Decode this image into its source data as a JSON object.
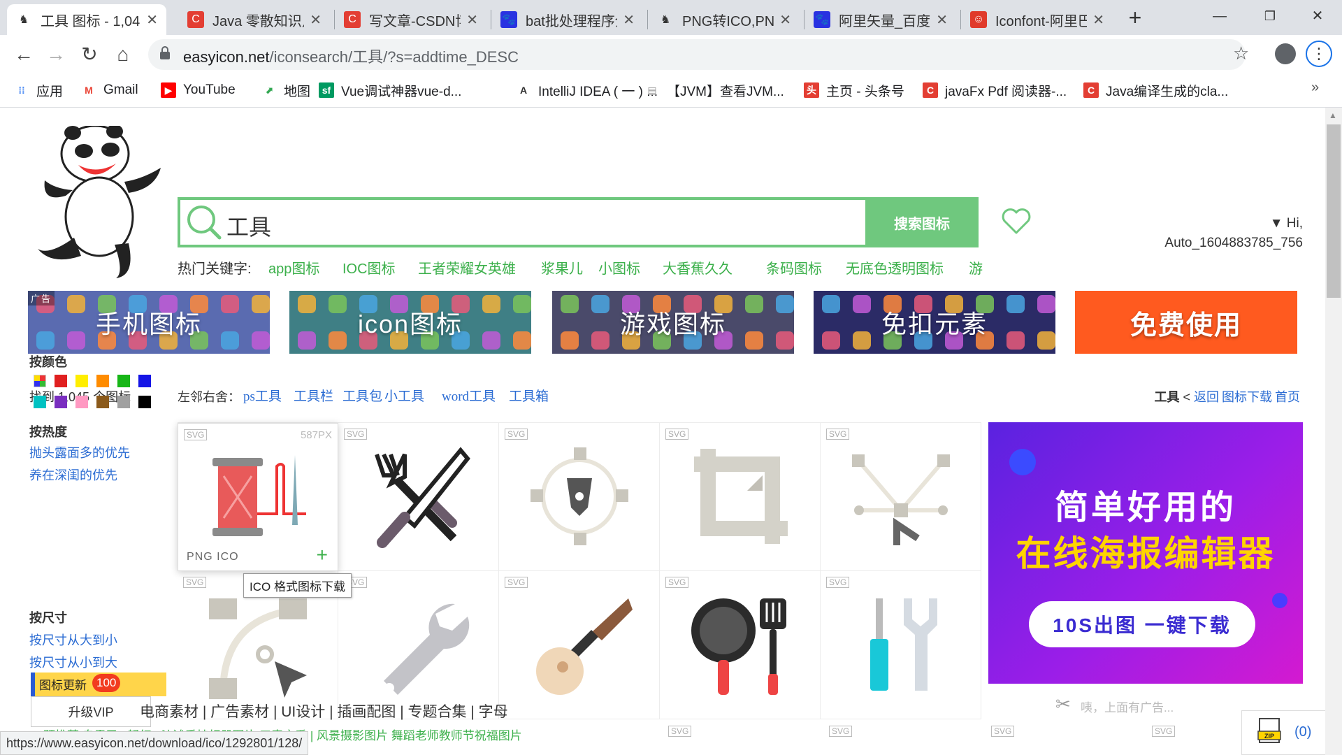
{
  "browser": {
    "tabs": [
      {
        "title": "工具 图标 - 1,045",
        "icon": "panda-favicon",
        "icon_color": "#333333",
        "active": true
      },
      {
        "title": "Java 零散知识点",
        "icon": "csdn-favicon",
        "icon_color": "#e33e33"
      },
      {
        "title": "写文章-CSDN博客",
        "icon": "csdn-favicon",
        "icon_color": "#e33e33"
      },
      {
        "title": "bat批处理程序介绍",
        "icon": "baidu-paw-favicon",
        "icon_color": "#2932e1"
      },
      {
        "title": "PNG转ICO,PNG",
        "icon": "panda-favicon",
        "icon_color": "#333333"
      },
      {
        "title": "阿里矢量_百度搜索",
        "icon": "baidu-paw-favicon",
        "icon_color": "#2932e1"
      },
      {
        "title": "Iconfont-阿里巴巴",
        "icon": "iconfont-favicon",
        "icon_color": "#e03a2b"
      }
    ],
    "close_glyph": "✕",
    "new_tab_glyph": "+",
    "window_controls": {
      "minimize": "—",
      "maximize": "❐",
      "close": "✕"
    },
    "nav": {
      "back": "←",
      "forward": "→",
      "reload": "↻",
      "home": "⌂"
    },
    "url": {
      "host": "easyicon.net",
      "path": "/iconsearch/工具/?s=addtime_DESC"
    },
    "menu_glyph": "⋮",
    "bookmarks": [
      {
        "label": "应用",
        "icon": "apps-grid-icon",
        "color": "#4285f4"
      },
      {
        "label": "Gmail",
        "icon": "gmail-icon",
        "color": "#ea4335"
      },
      {
        "label": "YouTube",
        "icon": "youtube-icon",
        "color": "#ff0000"
      },
      {
        "label": "地图",
        "icon": "maps-icon",
        "color": "#34a853"
      },
      {
        "label": "Vue调试神器vue-d...",
        "icon": "segmentfault-icon",
        "color": "#009a61"
      },
      {
        "label": "IntelliJ IDEA ( 一 ) ...",
        "icon": "intellij-icon",
        "color": "#333333"
      },
      {
        "label": "【JVM】查看JVM...",
        "icon": "doc-icon",
        "color": "#999999"
      },
      {
        "label": "主页 - 头条号",
        "icon": "toutiao-icon",
        "color": "#e33e33"
      },
      {
        "label": "javaFx Pdf 阅读器-...",
        "icon": "csdn-favicon",
        "color": "#e33e33"
      },
      {
        "label": "Java编译生成的cla...",
        "icon": "csdn-favicon",
        "color": "#e33e33"
      }
    ],
    "bookmarks_more": "»",
    "status_url": "https://www.easyicon.net/download/ico/1292801/128/"
  },
  "site": {
    "search_value": "工具",
    "search_button": "搜索图标",
    "user": {
      "greeting": "▼ Hi,",
      "name": "Auto_1604883785_756"
    },
    "hot_label": "热门关键字:",
    "hot_keywords": [
      "app图标",
      "IOC图标",
      "王者荣耀女英雄",
      "浆果儿",
      "小图标",
      "大香蕉久久",
      "条码图标",
      "无底色透明图标",
      "游"
    ],
    "banners": [
      {
        "label": "手机图标",
        "ad_tag": "广告",
        "bg": "#5a6bb0"
      },
      {
        "label": "icon图标",
        "bg": "#3f7f85"
      },
      {
        "label": "游戏图标",
        "bg": "#4a4a6a"
      },
      {
        "label": "免扣元素",
        "bg": "#2b2b66"
      },
      {
        "label": "免费使用",
        "bg": "#ff5a1f"
      }
    ],
    "found": {
      "prefix": "找到",
      "count": "1,045",
      "suffix": "个图标"
    },
    "related_label": "左邻右舍：",
    "related": [
      "ps工具",
      "工具栏",
      "工具包",
      "小工具",
      "word工具",
      "工具箱"
    ],
    "breadcrumb": {
      "current": "工具",
      "sep": "<",
      "links": [
        "返回",
        "图标下载",
        "首页"
      ]
    },
    "sidebar": {
      "color_title": "按颜色",
      "colors": [
        "#ffffff",
        "#e02020",
        "#ffee00",
        "#ff8c00",
        "#17b617",
        "#1515e6",
        "#00c2c2",
        "#7a2ec0",
        "#ff99c2",
        "#8b5a1b",
        "#a0a0a0",
        "#000000"
      ],
      "heat_title": "按热度",
      "heat_links": [
        "抛头露面多的优先",
        "养在深闺的优先"
      ],
      "size_title": "按尺寸",
      "size_links": [
        "按尺寸从大到小",
        "按尺寸从小到大"
      ]
    },
    "grid": {
      "svg_tag": "SVG",
      "icons": [
        {
          "name": "thread-spool-needle-icon"
        },
        {
          "name": "fork-knife-crossed-icon"
        },
        {
          "name": "pen-tool-icon"
        },
        {
          "name": "crop-tool-icon"
        },
        {
          "name": "vector-nodes-icon"
        },
        {
          "name": "bezier-curve-icon"
        },
        {
          "name": "wrench-icon"
        },
        {
          "name": "ukulele-icon"
        },
        {
          "name": "pan-spatula-icon"
        },
        {
          "name": "screwdriver-wrench-icon"
        }
      ],
      "hover": {
        "size": "587PX",
        "formats": "PNG  ICO",
        "add": "+"
      },
      "tooltip": "ICO 格式图标下载"
    },
    "ad_right": {
      "line1": "简单好用的",
      "line2": "在线海报编辑器",
      "button": "10S出图 一键下载"
    },
    "ad_note": "咦，上面有广告...",
    "update": {
      "label": "图标更新",
      "badge": "100"
    },
    "vip": "升级VIP",
    "footer_links": "电商素材 | 广告素材 | UI设计 | 插画配图 | 专题合集 | 字母",
    "seo_links": "预推荐 自露已 | 轻红 | 沙滩手持相册图片  三素文系 | 风景摄影图片  舞蹈老师教师节祝福图片",
    "download_count": "(0)"
  }
}
